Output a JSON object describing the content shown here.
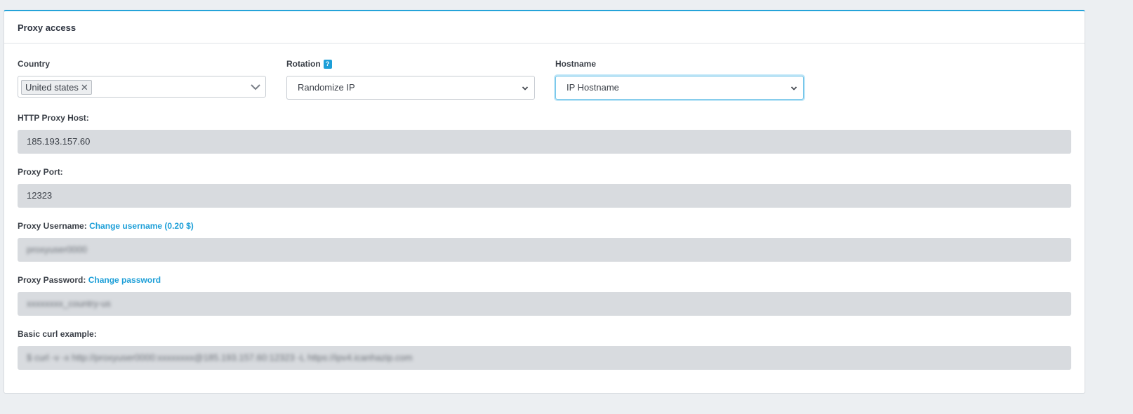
{
  "panel": {
    "title": "Proxy access"
  },
  "country": {
    "label": "Country",
    "selected": "United states",
    "remove_glyph": "✕"
  },
  "rotation": {
    "label": "Rotation",
    "help_glyph": "?",
    "value": "Randomize IP"
  },
  "hostname": {
    "label": "Hostname",
    "value": "IP Hostname"
  },
  "fields": {
    "http_host": {
      "label": "HTTP Proxy Host:",
      "value": "185.193.157.60"
    },
    "port": {
      "label": "Proxy Port:",
      "value": "12323"
    },
    "username": {
      "label": "Proxy Username:",
      "link": "Change username (0.20 $)",
      "value": "proxyuser0000"
    },
    "password": {
      "label": "Proxy Password:",
      "link": "Change password",
      "value": "xxxxxxxx_country-us"
    },
    "curl": {
      "label": "Basic curl example:",
      "value": "$ curl -v -x http://proxyuser0000:xxxxxxxx@185.193.157.60:12323 -L https://ipv4.icanhazip.com"
    }
  },
  "icons": {
    "chevron": "chevron-down-icon",
    "help": "help-icon",
    "remove": "close-icon"
  },
  "colors": {
    "accent": "#1d9fd8",
    "panel_top_border": "#25a3d9",
    "readonly_field_bg": "#d8dbdf",
    "page_bg": "#eceff2"
  }
}
